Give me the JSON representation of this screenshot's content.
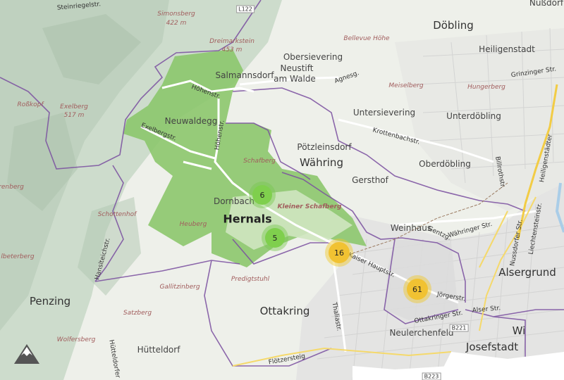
{
  "map": {
    "districts": [
      {
        "id": "doebling",
        "text": "Döbling"
      },
      {
        "id": "waehring",
        "text": "Währing"
      },
      {
        "id": "hernals",
        "text": "Hernals"
      },
      {
        "id": "ottakring",
        "text": "Ottakring"
      },
      {
        "id": "penzing",
        "text": "Penzing"
      },
      {
        "id": "alsergrund",
        "text": "Alsergrund"
      },
      {
        "id": "josefstadt",
        "text": "Josefstadt"
      },
      {
        "id": "wi",
        "text": "Wi"
      }
    ],
    "localities": [
      {
        "id": "heiligenstadt",
        "text": "Heiligenstadt"
      },
      {
        "id": "obersievering",
        "text": "Obersievering"
      },
      {
        "id": "neustift",
        "text": "Neustift"
      },
      {
        "id": "amwalde",
        "text": "am Walde"
      },
      {
        "id": "salmannsdorf",
        "text": "Salmannsdorf"
      },
      {
        "id": "neuwaldegg",
        "text": "Neuwaldegg"
      },
      {
        "id": "untersievering",
        "text": "Untersievering"
      },
      {
        "id": "unterdoebling",
        "text": "Unterdöbling"
      },
      {
        "id": "poetzleinsdorf",
        "text": "Pötzleinsdorf"
      },
      {
        "id": "oberdoebling",
        "text": "Oberdöbling"
      },
      {
        "id": "gersthof",
        "text": "Gersthof"
      },
      {
        "id": "dornbach",
        "text": "Dornbach"
      },
      {
        "id": "weinhaus",
        "text": "Weinhaus"
      },
      {
        "id": "huetteldorf",
        "text": "Hütteldorf"
      },
      {
        "id": "neulerchenfeld",
        "text": "Neulerchenfeld"
      },
      {
        "id": "nussdorf",
        "text": "Nußdorf"
      }
    ],
    "pois": [
      {
        "id": "simonsberg",
        "text": "Simonsberg"
      },
      {
        "id": "simonsberg-h",
        "text": "422 m"
      },
      {
        "id": "dreimarkstein",
        "text": "Dreimarkstein"
      },
      {
        "id": "dreimarkstein-h",
        "text": "453 m"
      },
      {
        "id": "bellevue",
        "text": "Bellevue Höhe"
      },
      {
        "id": "rosskopf",
        "text": "Roßkopf"
      },
      {
        "id": "exelberg",
        "text": "Exelberg"
      },
      {
        "id": "exelberg-h",
        "text": "517 m"
      },
      {
        "id": "meiselberg",
        "text": "Meiselberg"
      },
      {
        "id": "hungerberg",
        "text": "Hungerberg"
      },
      {
        "id": "schafberg",
        "text": "Schafberg"
      },
      {
        "id": "kleinerschafberg",
        "text": "Kleiner Schafberg"
      },
      {
        "id": "schottenhof",
        "text": "Schottenhof"
      },
      {
        "id": "heuberg",
        "text": "Heuberg"
      },
      {
        "id": "renberg",
        "text": "renberg"
      },
      {
        "id": "predigtstuhl",
        "text": "Predigtstuhl"
      },
      {
        "id": "gallitzinberg",
        "text": "Gallitzinberg"
      },
      {
        "id": "satzberg",
        "text": "Satzberg"
      },
      {
        "id": "wolfersberg",
        "text": "Wolfersberg"
      },
      {
        "id": "beterberg",
        "text": "lbeterberg"
      }
    ],
    "streets": [
      {
        "id": "hoehenstr1",
        "text": "Höhenstr."
      },
      {
        "id": "hoehenstr2",
        "text": "Höhenstr."
      },
      {
        "id": "exelbergstr",
        "text": "Exelbergstr."
      },
      {
        "id": "agnesg",
        "text": "Agnesg."
      },
      {
        "id": "krottenbach",
        "text": "Krottenbachstr."
      },
      {
        "id": "grinzinger",
        "text": "Grinzinger Str."
      },
      {
        "id": "heiligenstaedter",
        "text": "Heiligenstädter"
      },
      {
        "id": "billroth",
        "text": "Billrothstr."
      },
      {
        "id": "gentzg",
        "text": "Gentzg."
      },
      {
        "id": "waehringer",
        "text": "Währinger Str."
      },
      {
        "id": "kaiserhaupt",
        "text": "Kaiser Hauptstr."
      },
      {
        "id": "joergerstr",
        "text": "Jörgerstr."
      },
      {
        "id": "ottakringer",
        "text": "Ottakringer Str."
      },
      {
        "id": "thaliastr",
        "text": "Thaliastr."
      },
      {
        "id": "fluetzersteig",
        "text": "Flötzersteig"
      },
      {
        "id": "huetteldorfer",
        "text": "Hütteldorfer"
      },
      {
        "id": "hanslteich",
        "text": "Hanslteichstr."
      },
      {
        "id": "steinriegl",
        "text": "Steinriegelstr."
      },
      {
        "id": "liechtenstein",
        "text": "Liechtensteinstr."
      },
      {
        "id": "nussdorfer",
        "text": "Nussdorfer Str."
      },
      {
        "id": "alserstr",
        "text": "Alser Str."
      },
      {
        "id": "l122",
        "text": "L122"
      },
      {
        "id": "b221",
        "text": "B221"
      },
      {
        "id": "b223",
        "text": "B223"
      }
    ],
    "clusters": [
      {
        "id": "c6",
        "count": "6",
        "level": "green"
      },
      {
        "id": "c5",
        "count": "5",
        "level": "green"
      },
      {
        "id": "c16",
        "count": "16",
        "level": "yellow"
      },
      {
        "id": "c61",
        "count": "61",
        "level": "yellow"
      }
    ],
    "colors": {
      "background": "#eef0ea",
      "hills": "#c8d8c8",
      "district_fill": "#8cc66d",
      "boundary": "#7a4fa0",
      "highway": "#f2cc45",
      "cluster_green": "#7fcf4d",
      "cluster_yellow": "#f1c232"
    },
    "logo_icon": "mountain-logo-icon"
  }
}
